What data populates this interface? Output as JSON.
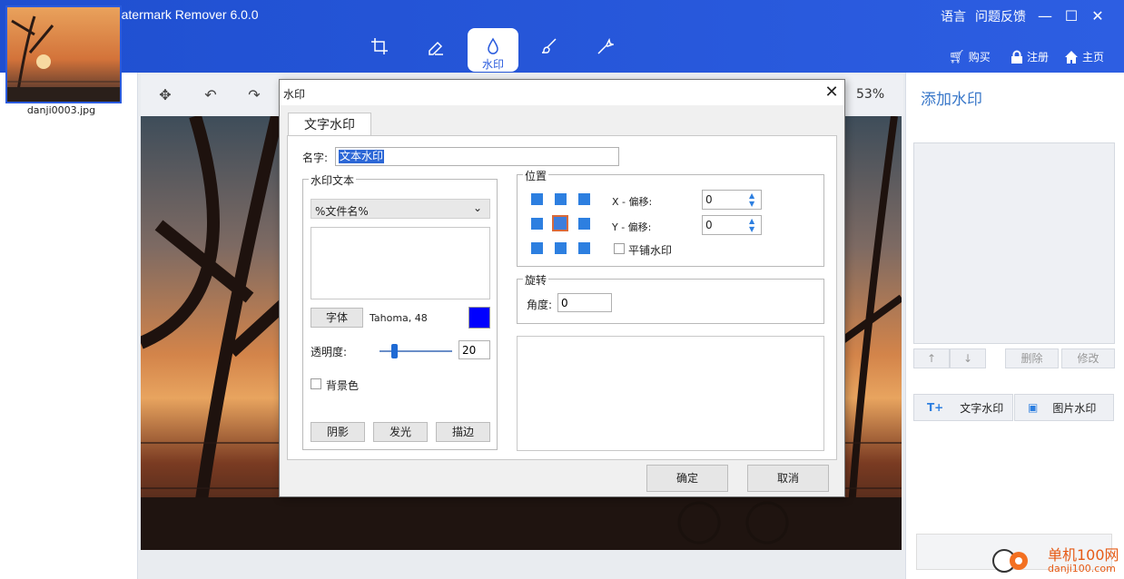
{
  "app": {
    "title": "ThunderSoft Watermark Remover 6.0.0",
    "menu_language": "语言",
    "menu_feedback": "问题反馈",
    "buy_label": "购买",
    "register_label": "注册",
    "home_label": "主页"
  },
  "toolbar": {
    "add_label": "+",
    "minus_label": "−",
    "close_label": "×",
    "active_tab_label": "水印"
  },
  "left_panel": {
    "thumbnail_name": "danji0003.jpg"
  },
  "canvas": {
    "zoom": "53%"
  },
  "right_panel": {
    "title": "添加水印",
    "delete_label": "删除",
    "modify_label": "修改",
    "text_watermark_label": "文字水印",
    "image_watermark_label": "图片水印"
  },
  "dialog": {
    "title": "水印",
    "tab_label": "文字水印",
    "name_label": "名字:",
    "name_value": "文本水印",
    "wm_text_group": "水印文本",
    "wm_text_select": "%文件名%",
    "font_button": "字体",
    "font_desc": "Tahoma, 48",
    "color": "#0000ff",
    "opacity_label": "透明度:",
    "opacity_value": "20",
    "opacity_percent": 20,
    "bg_color_label": "背景色",
    "shadow_button": "阴影",
    "glow_button": "发光",
    "stroke_button": "描边",
    "position_group": "位置",
    "x_offset_label": "X - 偏移:",
    "x_offset_value": "0",
    "y_offset_label": "Y - 偏移:",
    "y_offset_value": "0",
    "tile_label": "平铺水印",
    "rotate_group": "旋转",
    "angle_label": "角度:",
    "angle_value": "0",
    "ok_button": "确定",
    "cancel_button": "取消"
  },
  "watermark_logo": {
    "text_cn": "单机100网",
    "text_url": "danji100.com"
  }
}
